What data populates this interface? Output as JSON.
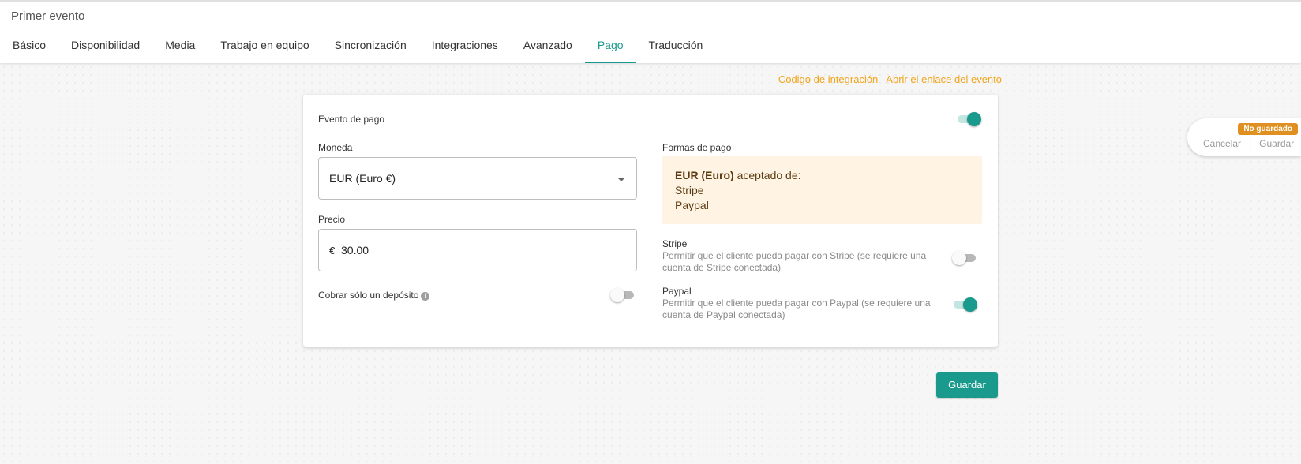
{
  "header": {
    "title": "Primer evento",
    "tabs": [
      {
        "label": "Básico"
      },
      {
        "label": "Disponibilidad"
      },
      {
        "label": "Media"
      },
      {
        "label": "Trabajo en equipo"
      },
      {
        "label": "Sincronización"
      },
      {
        "label": "Integraciones"
      },
      {
        "label": "Avanzado"
      },
      {
        "label": "Pago",
        "active": true
      },
      {
        "label": "Traducción"
      }
    ]
  },
  "links": {
    "integration_code": "Codigo de integración",
    "open_event_link": "Abrir el enlace del evento"
  },
  "payment": {
    "paid_event_label": "Evento de pago",
    "paid_event_enabled": true,
    "currency_label": "Moneda",
    "currency_value": "EUR (Euro €)",
    "price_label": "Precio",
    "price_symbol": "€",
    "price_value": "30.00",
    "deposit_label": "Cobrar sólo un depósito",
    "deposit_enabled": false,
    "methods_label": "Formas de pago",
    "accepted_currency": "EUR (Euro)",
    "accepted_text": "aceptado de:",
    "accepted_methods": [
      "Stripe",
      "Paypal"
    ],
    "stripe": {
      "title": "Stripe",
      "description": "Permitir que el cliente pueda pagar con Stripe (se requiere una cuenta de Stripe conectada)",
      "enabled": false
    },
    "paypal": {
      "title": "Paypal",
      "description": "Permitir que el cliente pueda pagar con Paypal (se requiere una cuenta de Paypal conectada)",
      "enabled": true
    }
  },
  "save_button": "Guardar",
  "side_panel": {
    "badge": "No guardado",
    "cancel": "Cancelar",
    "separator": "|",
    "save": "Guardar"
  },
  "colors": {
    "accent": "#1a9a8c",
    "link": "#f2a41a",
    "badge": "#e09020",
    "info_box": "#fff3e3"
  }
}
